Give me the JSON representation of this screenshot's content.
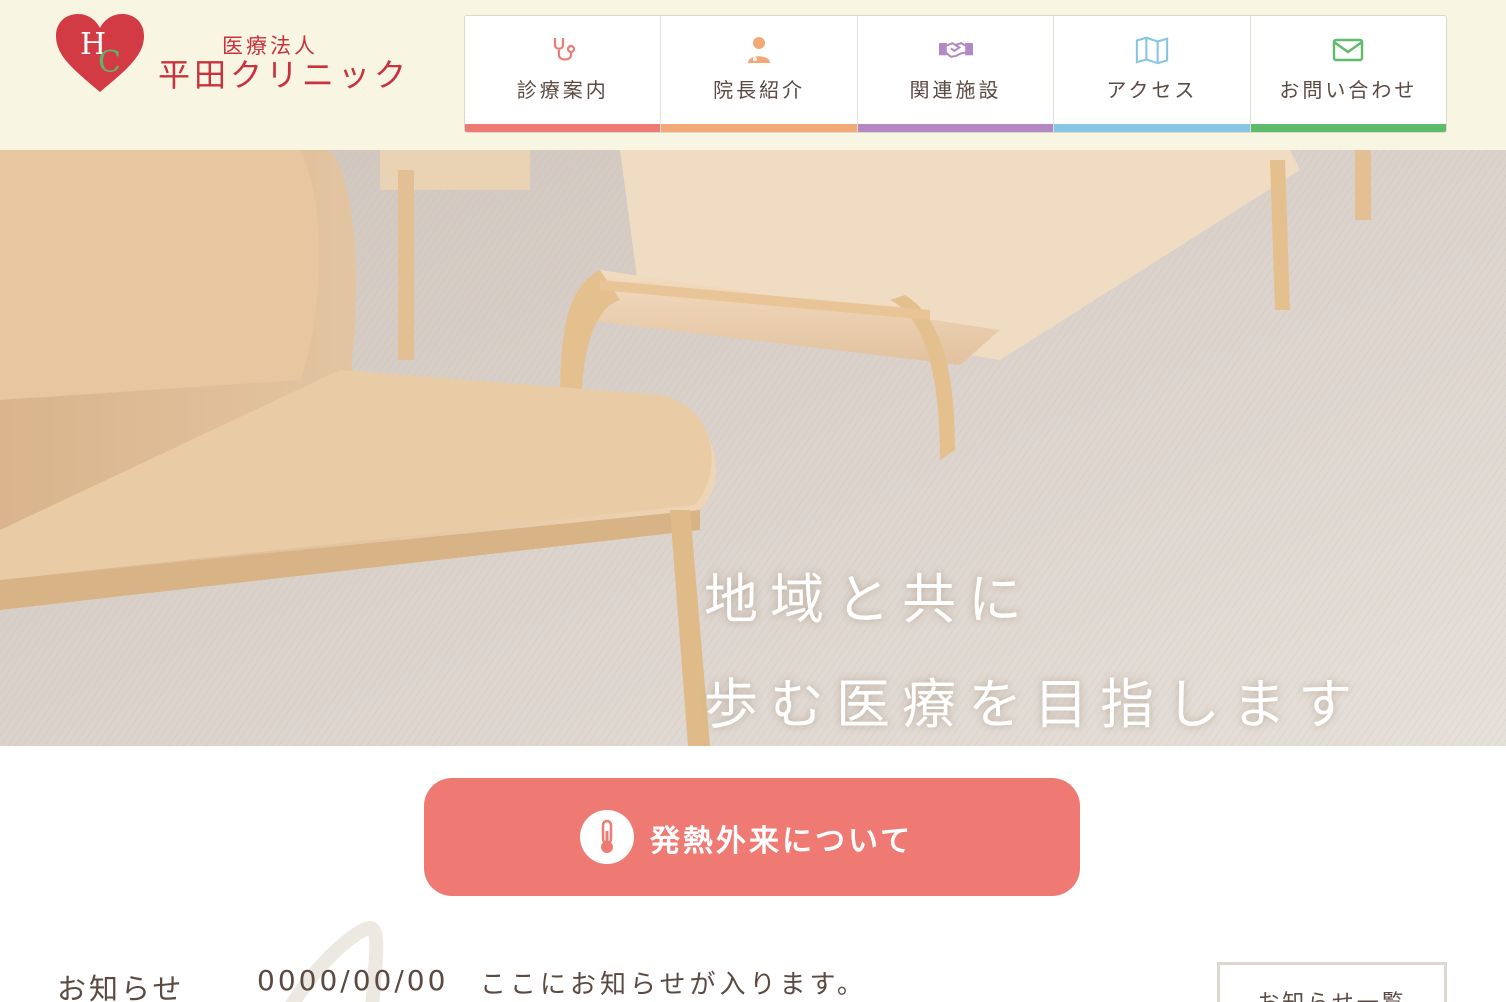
{
  "header": {
    "logo_initials": "HC",
    "logo_sub": "医療法人",
    "logo_name": "平田クリニック"
  },
  "nav": {
    "items": [
      {
        "label": "診療案内",
        "icon": "stethoscope-icon",
        "color": "#ee7a74"
      },
      {
        "label": "院長紹介",
        "icon": "doctor-icon",
        "color": "#f3a878"
      },
      {
        "label": "関連施設",
        "icon": "handshake-icon",
        "color": "#b488c2"
      },
      {
        "label": "アクセス",
        "icon": "map-icon",
        "color": "#86c6e4"
      },
      {
        "label": "お問い合わせ",
        "icon": "mail-icon",
        "color": "#5dbb6a"
      }
    ]
  },
  "hero": {
    "line1": "地域と共に",
    "line2": "歩む医療を目指します"
  },
  "fever": {
    "label": "発熱外来について",
    "icon": "thermometer-icon",
    "color": "#ef7a74"
  },
  "news": {
    "heading": "お知らせ",
    "date": "0000/00/00",
    "text": "ここにお知らせが入ります。",
    "more_label": "お知らせ一覧"
  },
  "colors": {
    "header_bg": "#f9f5e3",
    "brand_red": "#c8323c",
    "text": "#5a4a42"
  }
}
